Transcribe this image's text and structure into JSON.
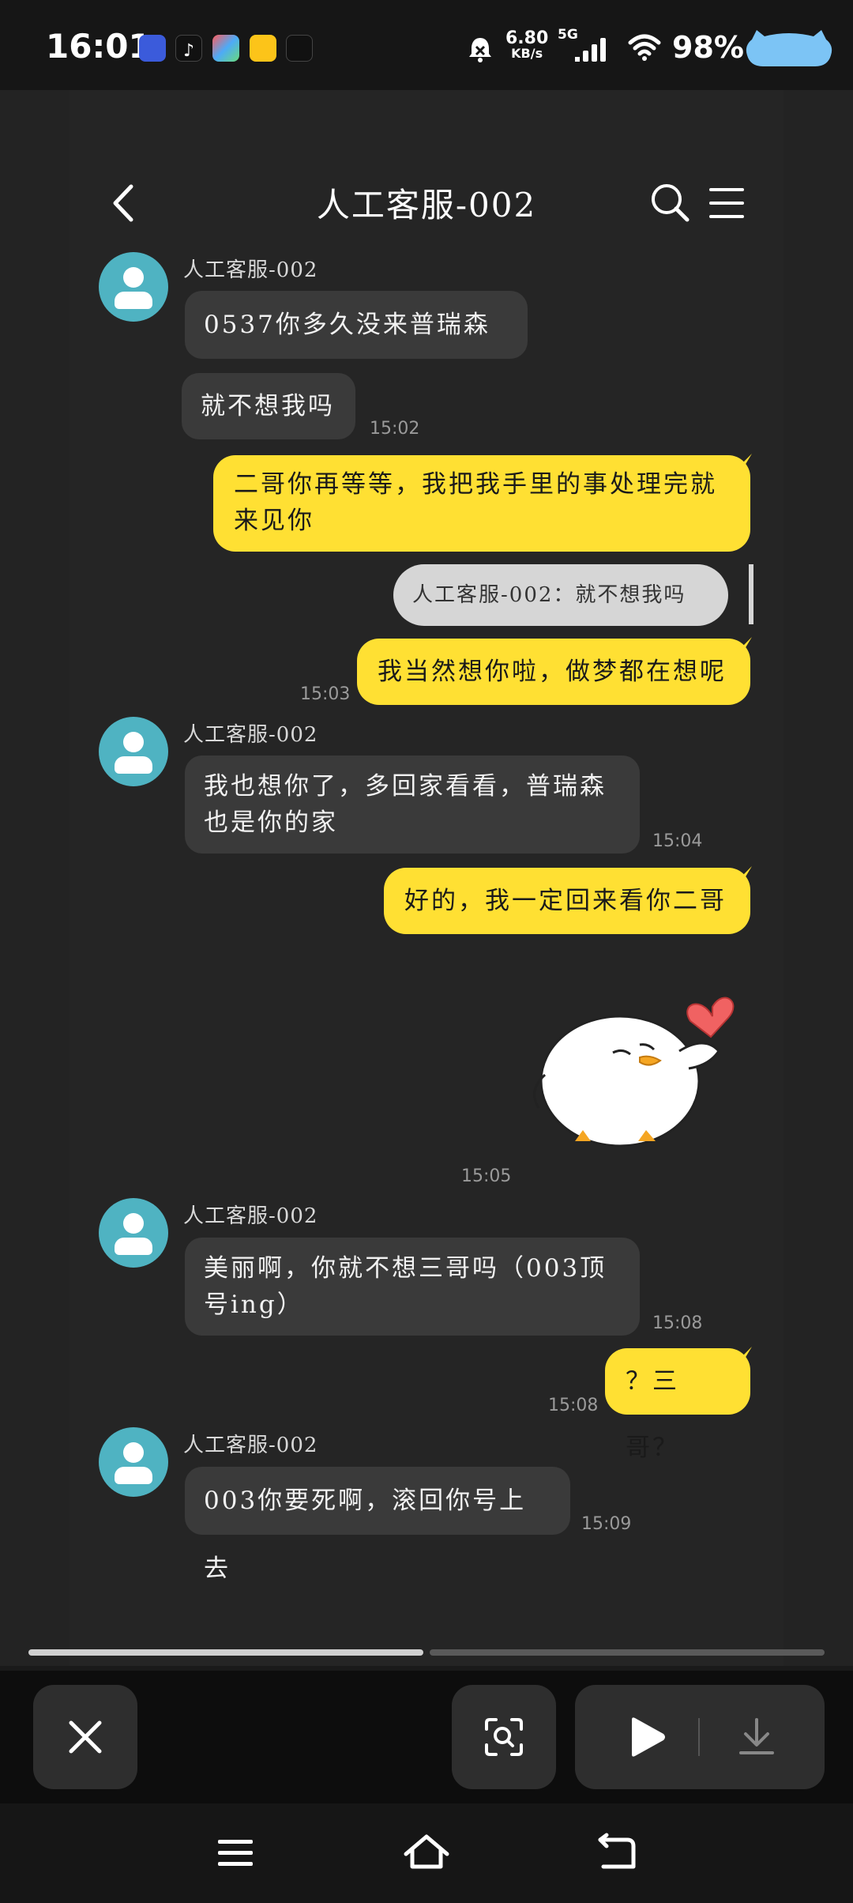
{
  "status_bar": {
    "time": "16:01",
    "net_speed_value": "6.80",
    "net_speed_unit": "KB/s",
    "network_type": "5G",
    "battery": "98%"
  },
  "header": {
    "title": "人工客服-002"
  },
  "messages": [
    {
      "sender": "人工客服-002",
      "text": "0537你多久没来普瑞森了"
    },
    {
      "text": "就不想我吗",
      "time": "15:02"
    },
    {
      "text_line1": "二哥你再等等，我把我手里的事处理完就",
      "text_line2": "来见你"
    },
    {
      "quote": "人工客服-002：就不想我吗"
    },
    {
      "text": "我当然想你啦，做梦都在想呢",
      "time": "15:03"
    },
    {
      "sender": "人工客服-002",
      "text_line1": "我也想你了，多回家看看，普瑞森",
      "text_line2": "也是你的家",
      "time": "15:04"
    },
    {
      "text": "好的，我一定回来看你二哥"
    },
    {
      "sticker": "duck-heart-sticker",
      "time": "15:05"
    },
    {
      "sender": "人工客服-002",
      "text_line1": "美丽啊，你就不想三哥吗（003顶",
      "text_line2": "号ing）",
      "time": "15:08"
    },
    {
      "text": "？三哥？",
      "time": "15:08"
    },
    {
      "sender": "人工客服-002",
      "text": "003你要死啊，滚回你号上去",
      "time": "15:09"
    }
  ],
  "progress": {
    "first_segment": 0.5,
    "second_segment": 0.5
  },
  "colors": {
    "outgoing_bubble": "#ffe033",
    "incoming_bubble": "#3a3a3a",
    "avatar": "#4fb3c2"
  }
}
